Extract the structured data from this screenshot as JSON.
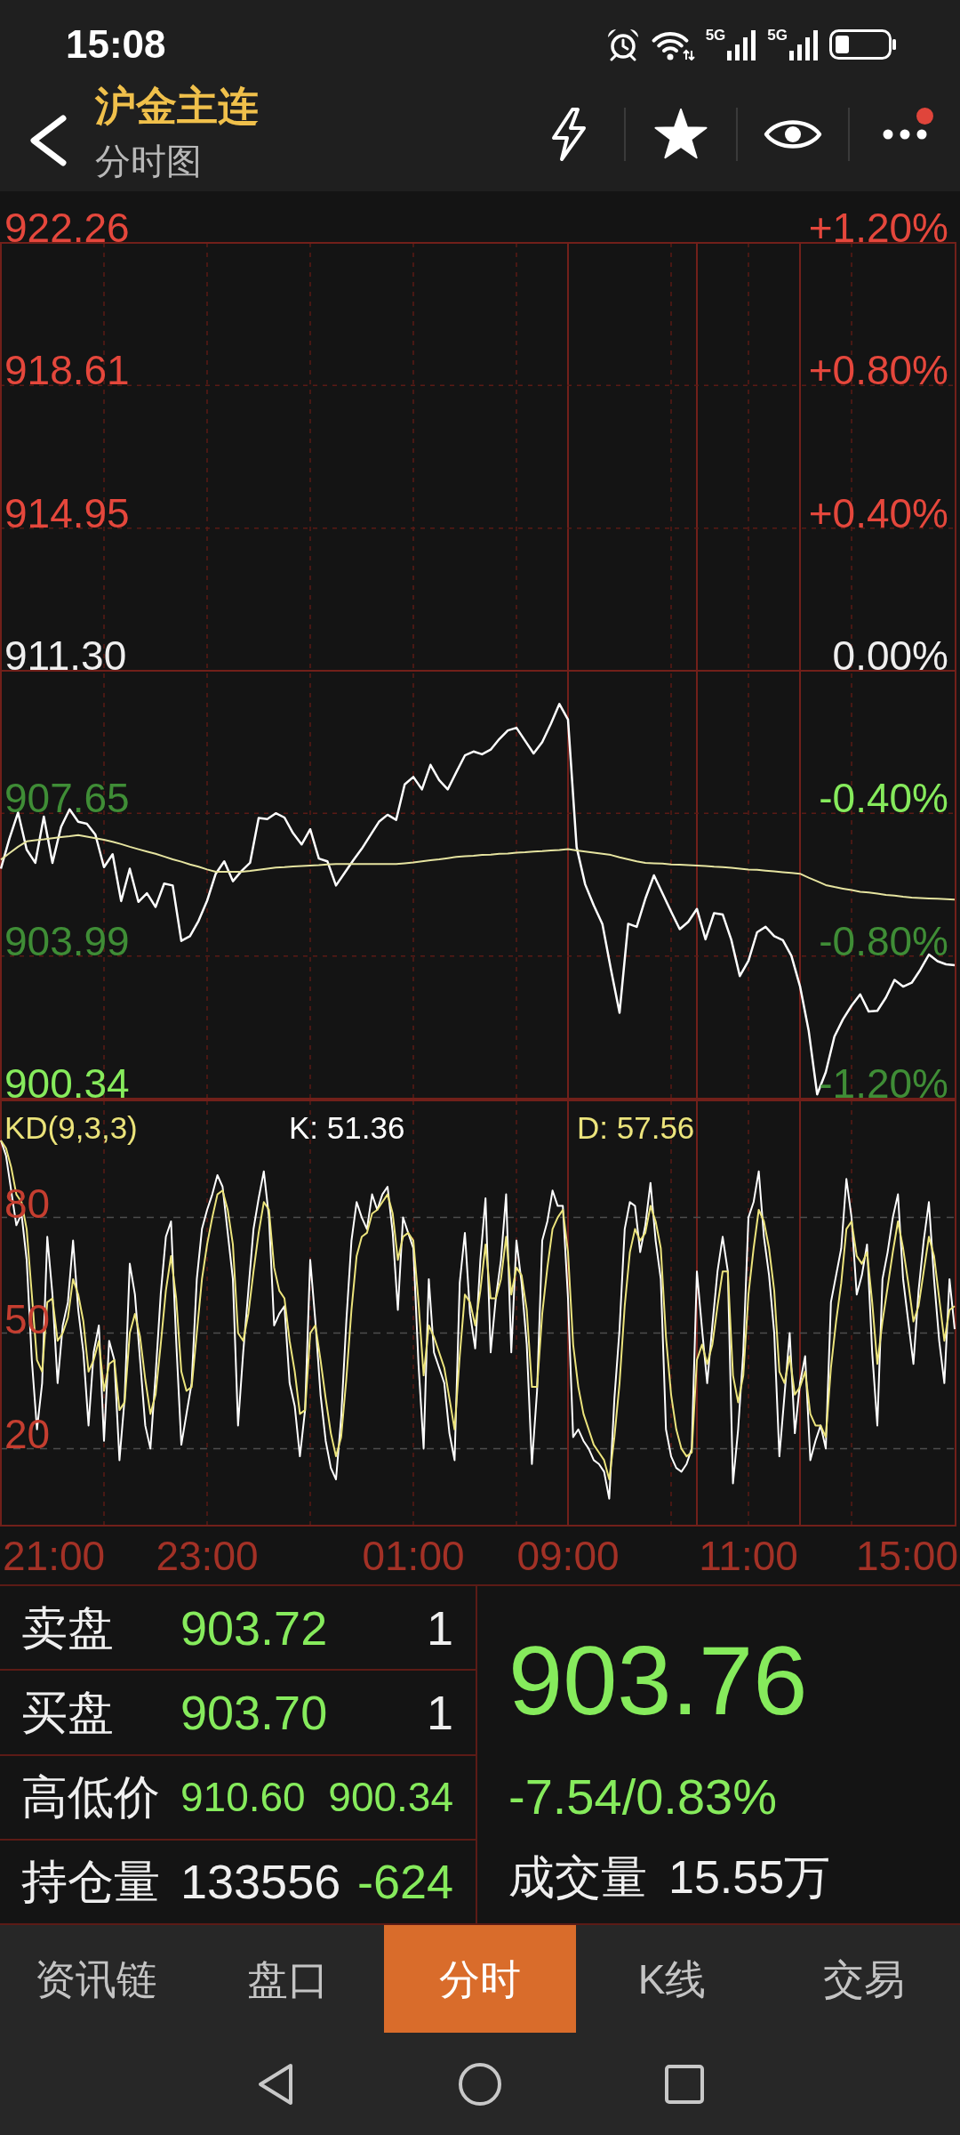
{
  "status_bar": {
    "time": "15:08",
    "networks": [
      {
        "label": "5G"
      },
      {
        "label": "5G"
      }
    ]
  },
  "header": {
    "title": "沪金主连",
    "subtitle": "分时图",
    "notification": true
  },
  "price_chart": {
    "scale": [
      {
        "change": "+1.20%",
        "kind": "up",
        "price_dimmed": false,
        "change_dimmed": false
      },
      {
        "change": "+0.80%",
        "kind": "up",
        "price_dimmed": false,
        "change_dimmed": false
      },
      {
        "change": "+0.40%",
        "kind": "up",
        "price_dimmed": false,
        "change_dimmed": false
      },
      {
        "change": "0.00%",
        "kind": "flat",
        "price_dimmed": false,
        "change_dimmed": false
      },
      {
        "change": "-0.40%",
        "kind": "down",
        "price_dimmed": true,
        "change_dimmed": false
      },
      {
        "change": "-0.80%",
        "kind": "down",
        "price_dimmed": true,
        "change_dimmed": true
      },
      {
        "change": "-1.20%",
        "kind": "down",
        "price_dimmed": false,
        "change_dimmed": true
      }
    ],
    "chart_data": {
      "type": "line",
      "grid": true,
      "ylim": [
        900.34,
        922.26
      ],
      "yticks": [
        {
          "value": 922.26,
          "label": "922.26"
        },
        {
          "value": 918.61,
          "label": "918.61"
        },
        {
          "value": 914.95,
          "label": "914.95"
        },
        {
          "value": 911.3,
          "label": "911.30"
        },
        {
          "value": 907.65,
          "label": "907.65"
        },
        {
          "value": 903.99,
          "label": "903.99"
        },
        {
          "value": 900.34,
          "label": "900.34"
        }
      ],
      "categories": [
        null,
        null,
        null,
        null,
        null,
        null,
        null,
        null,
        null,
        null,
        null,
        null,
        null,
        null,
        null,
        null,
        null,
        null,
        null,
        null,
        null,
        null,
        null,
        null,
        null,
        null,
        null,
        null,
        null,
        null,
        null,
        null,
        null,
        null,
        null,
        null,
        null,
        null,
        null,
        null,
        null,
        null,
        null,
        null,
        null,
        null,
        null,
        null,
        null,
        null,
        null,
        null,
        null,
        null,
        null,
        null,
        null,
        null,
        null,
        null,
        null,
        null,
        null,
        null,
        null,
        null,
        null,
        null,
        null,
        null,
        null,
        null,
        null,
        null,
        null,
        null,
        null,
        null,
        null,
        null,
        null,
        null,
        null,
        null,
        null,
        null,
        null,
        null,
        null,
        null,
        null,
        null,
        null,
        null,
        null,
        null,
        null,
        null,
        null,
        null,
        null,
        null,
        null,
        null,
        null,
        null,
        null,
        null,
        null,
        null,
        null,
        null
      ],
      "series": [
        {
          "color": "#ffffff",
          "values": [
            906.23,
            907.01,
            907.67,
            906.72,
            906.38,
            907.56,
            906.38,
            907.3,
            907.75,
            907.43,
            907.38,
            907.1,
            906.27,
            906.6,
            905.4,
            906.23,
            905.38,
            905.6,
            905.25,
            905.85,
            905.8,
            904.38,
            904.5,
            904.89,
            905.41,
            906.1,
            906.42,
            905.91,
            906.17,
            906.38,
            907.53,
            907.5,
            907.65,
            907.54,
            907.14,
            906.85,
            907.24,
            906.49,
            906.42,
            905.8,
            906.12,
            906.44,
            906.74,
            907.09,
            907.43,
            907.61,
            907.48,
            908.39,
            908.58,
            908.26,
            908.89,
            908.5,
            908.26,
            908.7,
            909.13,
            909.23,
            909.16,
            909.28,
            909.55,
            909.77,
            909.84,
            909.51,
            909.18,
            909.47,
            909.94,
            910.45,
            910.05,
            906.78,
            905.83,
            905.29,
            904.81,
            903.65,
            902.54,
            904.82,
            904.74,
            905.46,
            906.06,
            905.6,
            905.13,
            904.68,
            904.87,
            905.2,
            904.42,
            905.09,
            905.06,
            904.41,
            903.48,
            903.87,
            904.6,
            904.74,
            904.5,
            904.4,
            904.0,
            903.22,
            902.09,
            900.45,
            901.02,
            901.93,
            902.37,
            902.72,
            903.01,
            902.57,
            902.59,
            902.93,
            903.38,
            903.21,
            903.31,
            903.64,
            904.03,
            903.86,
            903.78,
            903.76
          ]
        },
        {
          "color": "#e6e4a0",
          "values": [
            906.46,
            906.63,
            906.79,
            906.93,
            906.96,
            906.98,
            907.01,
            907.04,
            907.06,
            907.09,
            907.05,
            907.01,
            906.97,
            906.92,
            906.86,
            906.79,
            906.73,
            906.67,
            906.61,
            906.54,
            906.47,
            906.41,
            906.34,
            906.28,
            906.21,
            906.15,
            906.15,
            906.15,
            906.15,
            906.17,
            906.2,
            906.23,
            906.26,
            906.27,
            906.29,
            906.3,
            906.31,
            906.32,
            906.34,
            906.35,
            906.35,
            906.35,
            906.35,
            906.35,
            906.35,
            906.35,
            906.35,
            906.37,
            906.39,
            906.42,
            906.45,
            906.47,
            906.5,
            906.53,
            906.55,
            906.56,
            906.58,
            906.59,
            906.61,
            906.62,
            906.64,
            906.65,
            906.67,
            906.68,
            906.7,
            906.71,
            906.73,
            906.7,
            906.67,
            906.64,
            906.61,
            906.58,
            906.52,
            906.47,
            906.42,
            906.38,
            906.37,
            906.36,
            906.34,
            906.33,
            906.32,
            906.31,
            906.3,
            906.28,
            906.27,
            906.25,
            906.23,
            906.21,
            906.2,
            906.18,
            906.16,
            906.14,
            906.12,
            906.1,
            906.0,
            905.91,
            905.81,
            905.76,
            905.72,
            905.68,
            905.64,
            905.62,
            905.59,
            905.56,
            905.54,
            905.51,
            905.49,
            905.48,
            905.47,
            905.46,
            905.45,
            905.44
          ]
        }
      ]
    }
  },
  "indicator": {
    "title": "KD(9,3,3)",
    "readings": [
      "K: 51.36",
      "D: 57.56"
    ],
    "axis_start": "21:00",
    "axis_end": "15:00",
    "chart_data": {
      "type": "line",
      "grid": true,
      "ylim": [
        0,
        110.4
      ],
      "yticks": [
        20,
        50,
        80
      ],
      "categories": [
        null,
        null,
        null,
        null,
        null,
        null,
        null,
        null,
        null,
        null,
        null,
        null,
        null,
        null,
        null,
        null,
        null,
        null,
        null,
        null,
        null,
        null,
        null,
        null,
        null,
        null,
        null,
        null,
        null,
        null,
        null,
        null,
        null,
        null,
        null,
        null,
        null,
        null,
        null,
        null,
        "23:00",
        null,
        null,
        null,
        null,
        null,
        null,
        null,
        null,
        null,
        null,
        null,
        null,
        null,
        null,
        null,
        null,
        null,
        null,
        null,
        null,
        null,
        null,
        null,
        null,
        null,
        null,
        null,
        null,
        null,
        null,
        null,
        null,
        null,
        null,
        null,
        null,
        null,
        null,
        null,
        "01:00",
        null,
        null,
        null,
        null,
        null,
        null,
        null,
        null,
        null,
        null,
        null,
        null,
        null,
        null,
        null,
        null,
        null,
        null,
        null,
        null,
        null,
        null,
        null,
        null,
        null,
        null,
        null,
        null,
        null,
        "09:00",
        null,
        null,
        null,
        null,
        null,
        null,
        null,
        null,
        null,
        null,
        null,
        null,
        null,
        null,
        null,
        null,
        null,
        null,
        null,
        null,
        null,
        null,
        null,
        null,
        null,
        null,
        null,
        null,
        null,
        null,
        null,
        null,
        null,
        null,
        "11:00",
        null,
        null,
        null,
        null,
        null,
        null,
        null,
        null,
        null,
        null,
        null,
        null,
        null,
        null,
        null,
        null,
        null,
        null,
        null,
        null,
        null,
        null,
        null,
        null,
        null,
        null,
        null,
        null,
        null,
        null,
        null,
        null,
        null,
        null,
        null,
        null,
        null,
        null,
        null,
        null
      ],
      "series": [
        {
          "color": "#ffffff",
          "values": [
            100,
            96,
            87,
            78,
            81,
            69,
            43,
            25,
            37,
            75,
            60,
            37,
            52,
            58,
            74,
            56,
            45,
            26,
            45,
            52,
            22,
            48,
            43,
            17,
            33,
            68,
            60,
            43,
            26,
            20,
            39,
            60,
            75,
            79,
            48,
            21,
            29,
            37,
            64,
            77,
            82,
            86,
            91,
            88,
            76,
            64,
            26,
            45,
            61,
            77,
            85,
            92,
            80,
            52,
            55,
            57,
            37,
            31,
            18,
            30,
            69,
            53,
            34,
            22,
            15,
            12,
            28,
            53,
            74,
            84,
            80,
            77,
            86,
            82,
            86,
            88,
            76,
            56,
            80,
            76,
            72,
            42,
            20,
            64,
            45,
            41,
            37,
            24,
            17,
            63,
            76,
            55,
            46,
            69,
            85,
            45,
            59,
            69,
            86,
            45,
            74,
            63,
            47,
            16,
            35,
            74,
            79,
            87,
            83,
            83,
            59,
            23,
            25,
            22,
            20,
            17,
            16,
            14,
            7,
            33,
            51,
            77,
            84,
            83,
            71,
            78,
            89,
            74,
            64,
            25,
            18,
            15,
            14,
            16,
            20,
            66,
            51,
            37,
            52,
            66,
            75,
            66,
            11,
            25,
            45,
            80,
            84,
            92,
            75,
            65,
            50,
            18,
            34,
            50,
            24,
            37,
            44,
            17,
            22,
            26,
            20,
            58,
            65,
            72,
            90,
            80,
            60,
            65,
            73,
            45,
            26,
            64,
            71,
            80,
            86,
            64,
            53,
            42,
            61,
            74,
            84,
            64,
            48,
            37,
            64,
            51
          ]
        },
        {
          "color": "#ece47c",
          "values": [
            100,
            98,
            93,
            86,
            84,
            77,
            60,
            43,
            40,
            58,
            59,
            48,
            50,
            54,
            64,
            60,
            53,
            40,
            43,
            48,
            35,
            42,
            43,
            30,
            32,
            50,
            55,
            49,
            38,
            29,
            34,
            47,
            61,
            70,
            59,
            40,
            35,
            36,
            50,
            64,
            73,
            80,
            86,
            87,
            82,
            73,
            50,
            48,
            55,
            66,
            76,
            84,
            82,
            67,
            61,
            59,
            48,
            40,
            29,
            30,
            50,
            52,
            43,
            33,
            24,
            18,
            23,
            38,
            56,
            70,
            75,
            76,
            81,
            82,
            84,
            86,
            81,
            69,
            75,
            76,
            74,
            58,
            39,
            52,
            49,
            45,
            41,
            33,
            25,
            44,
            60,
            58,
            52,
            61,
            73,
            59,
            59,
            64,
            75,
            60,
            67,
            65,
            56,
            36,
            36,
            55,
            67,
            77,
            80,
            82,
            71,
            47,
            36,
            29,
            25,
            21,
            19,
            17,
            12,
            23,
            37,
            57,
            71,
            77,
            74,
            76,
            83,
            79,
            72,
            49,
            34,
            25,
            20,
            18,
            19,
            43,
            47,
            42,
            47,
            57,
            66,
            66,
            39,
            32,
            39,
            60,
            72,
            82,
            79,
            72,
            61,
            40,
            37,
            44,
            34,
            36,
            40,
            29,
            26,
            26,
            23,
            41,
            53,
            63,
            77,
            79,
            70,
            68,
            71,
            58,
            42,
            53,
            62,
            71,
            79,
            72,
            63,
            53,
            57,
            66,
            75,
            70,
            59,
            48,
            56,
            57
          ]
        }
      ]
    }
  },
  "quote": {
    "rows": [
      {
        "kind": "quote",
        "label": "卖盘",
        "values": [
          {
            "text": "903.72",
            "color": "#86eb5c"
          },
          {
            "text": "1",
            "color": "#efefef"
          }
        ]
      },
      {
        "kind": "quote",
        "label": "买盘",
        "values": [
          {
            "text": "903.70",
            "color": "#86eb5c"
          },
          {
            "text": "1",
            "color": "#efefef"
          }
        ]
      },
      {
        "kind": "range",
        "label": "高低价",
        "values": [
          {
            "text": "910.60",
            "color": "#86eb5c"
          },
          {
            "text": "900.34",
            "color": "#86eb5c"
          }
        ]
      },
      {
        "kind": "quote",
        "label": "持仓量",
        "values": [
          {
            "text": "133556",
            "color": "#efefef"
          },
          {
            "text": "-624",
            "color": "#86eb5c"
          }
        ]
      }
    ],
    "last_price": "903.76",
    "change": "-7.54/0.83%",
    "color": "#86eb5c",
    "volume_label": "成交量",
    "volume": "15.55万"
  },
  "tabs": [
    {
      "label": "资讯链",
      "selected": false
    },
    {
      "label": "盘口",
      "selected": false
    },
    {
      "label": "分时",
      "selected": true
    },
    {
      "label": "K线",
      "selected": false
    },
    {
      "label": "交易",
      "selected": false
    }
  ]
}
